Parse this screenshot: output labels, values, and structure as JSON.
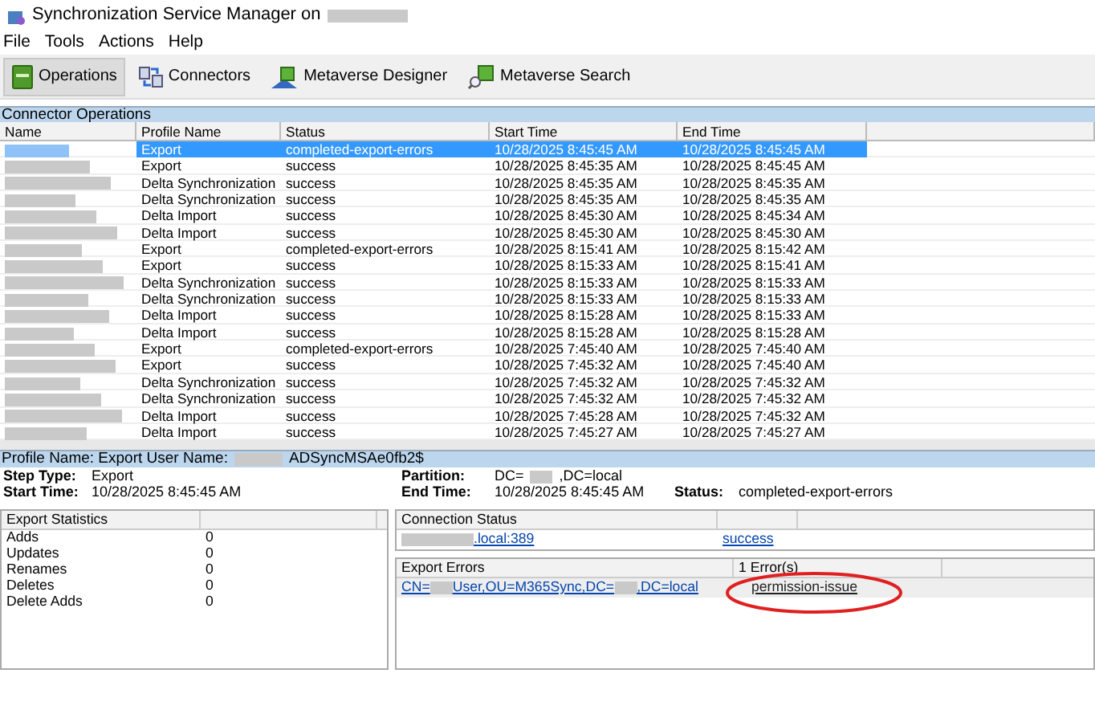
{
  "window": {
    "title": "Synchronization Service Manager on"
  },
  "menu": [
    "File",
    "Tools",
    "Actions",
    "Help"
  ],
  "toolbar": [
    {
      "label": "Operations",
      "kind": "operations",
      "selected": true
    },
    {
      "label": "Connectors",
      "kind": "connectors",
      "selected": false
    },
    {
      "label": "Metaverse Designer",
      "kind": "designer",
      "selected": false
    },
    {
      "label": "Metaverse Search",
      "kind": "search",
      "selected": false
    }
  ],
  "operations": {
    "title": "Connector Operations",
    "columns": [
      "Name",
      "Profile Name",
      "Status",
      "Start Time",
      "End Time"
    ],
    "rows": [
      {
        "profile": "Export",
        "status": "completed-export-errors",
        "start": "10/28/2025 8:45:45 AM",
        "end": "10/28/2025 8:45:45 AM",
        "selected": true
      },
      {
        "profile": "Export",
        "status": "success",
        "start": "10/28/2025 8:45:35 AM",
        "end": "10/28/2025 8:45:45 AM",
        "selected": false
      },
      {
        "profile": "Delta Synchronization",
        "status": "success",
        "start": "10/28/2025 8:45:35 AM",
        "end": "10/28/2025 8:45:35 AM",
        "selected": false
      },
      {
        "profile": "Delta Synchronization",
        "status": "success",
        "start": "10/28/2025 8:45:35 AM",
        "end": "10/28/2025 8:45:35 AM",
        "selected": false
      },
      {
        "profile": "Delta Import",
        "status": "success",
        "start": "10/28/2025 8:45:30 AM",
        "end": "10/28/2025 8:45:34 AM",
        "selected": false
      },
      {
        "profile": "Delta Import",
        "status": "success",
        "start": "10/28/2025 8:45:30 AM",
        "end": "10/28/2025 8:45:30 AM",
        "selected": false
      },
      {
        "profile": "Export",
        "status": "completed-export-errors",
        "start": "10/28/2025 8:15:41 AM",
        "end": "10/28/2025 8:15:42 AM",
        "selected": false
      },
      {
        "profile": "Export",
        "status": "success",
        "start": "10/28/2025 8:15:33 AM",
        "end": "10/28/2025 8:15:41 AM",
        "selected": false
      },
      {
        "profile": "Delta Synchronization",
        "status": "success",
        "start": "10/28/2025 8:15:33 AM",
        "end": "10/28/2025 8:15:33 AM",
        "selected": false
      },
      {
        "profile": "Delta Synchronization",
        "status": "success",
        "start": "10/28/2025 8:15:33 AM",
        "end": "10/28/2025 8:15:33 AM",
        "selected": false
      },
      {
        "profile": "Delta Import",
        "status": "success",
        "start": "10/28/2025 8:15:28 AM",
        "end": "10/28/2025 8:15:33 AM",
        "selected": false
      },
      {
        "profile": "Delta Import",
        "status": "success",
        "start": "10/28/2025 8:15:28 AM",
        "end": "10/28/2025 8:15:28 AM",
        "selected": false
      },
      {
        "profile": "Export",
        "status": "completed-export-errors",
        "start": "10/28/2025 7:45:40 AM",
        "end": "10/28/2025 7:45:40 AM",
        "selected": false
      },
      {
        "profile": "Export",
        "status": "success",
        "start": "10/28/2025 7:45:32 AM",
        "end": "10/28/2025 7:45:40 AM",
        "selected": false
      },
      {
        "profile": "Delta Synchronization",
        "status": "success",
        "start": "10/28/2025 7:45:32 AM",
        "end": "10/28/2025 7:45:32 AM",
        "selected": false
      },
      {
        "profile": "Delta Synchronization",
        "status": "success",
        "start": "10/28/2025 7:45:32 AM",
        "end": "10/28/2025 7:45:32 AM",
        "selected": false
      },
      {
        "profile": "Delta Import",
        "status": "success",
        "start": "10/28/2025 7:45:28 AM",
        "end": "10/28/2025 7:45:32 AM",
        "selected": false
      },
      {
        "profile": "Delta Import",
        "status": "success",
        "start": "10/28/2025 7:45:27 AM",
        "end": "10/28/2025 7:45:27 AM",
        "selected": false
      }
    ]
  },
  "details": {
    "profile_bar": "Profile Name: Export  User Name:",
    "user_suffix": "ADSyncMSAe0fb2$",
    "fields": [
      {
        "label": "Step Type:",
        "value": [
          "Export"
        ]
      },
      {
        "label": "Partition:",
        "value": [
          "DC=",
          ",DC=local"
        ]
      },
      {
        "label": "Start Time:",
        "value": [
          "10/28/2025 8:45:45 AM"
        ]
      },
      {
        "label": "End Time:",
        "value": [
          "10/28/2025 8:45:45 AM"
        ]
      }
    ],
    "status_label": "Status:",
    "status_value": "completed-export-errors"
  },
  "export_statistics": {
    "title": "Export Statistics",
    "rows": [
      {
        "label": "Adds",
        "value": "0"
      },
      {
        "label": "Updates",
        "value": "0"
      },
      {
        "label": "Renames",
        "value": "0"
      },
      {
        "label": "Deletes",
        "value": "0"
      },
      {
        "label": "Delete Adds",
        "value": "0"
      }
    ]
  },
  "connection_status": {
    "title": "Connection Status",
    "server": ".local:389",
    "result": "success"
  },
  "export_errors": {
    "title": "Export Errors",
    "count": "1 Error(s)",
    "dn": [
      "CN=",
      "User,OU=M365Sync,DC=",
      ",DC=local"
    ],
    "error": "permission-issue"
  }
}
